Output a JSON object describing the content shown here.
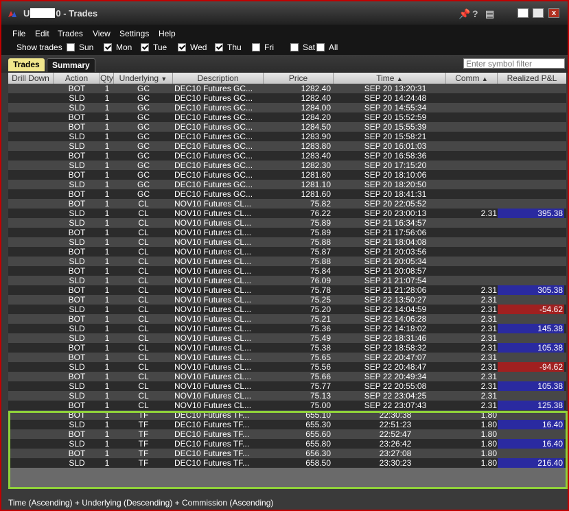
{
  "window": {
    "title_prefix": "U",
    "title_suffix": "0 - Trades"
  },
  "menu": [
    "File",
    "Edit",
    "Trades",
    "View",
    "Settings",
    "Help"
  ],
  "show_trades": {
    "label": "Show trades",
    "days": [
      {
        "label": "Sun",
        "checked": false
      },
      {
        "label": "Mon",
        "checked": true
      },
      {
        "label": "Tue",
        "checked": true
      },
      {
        "label": "Wed",
        "checked": true
      },
      {
        "label": "Thu",
        "checked": true
      },
      {
        "label": "Fri",
        "checked": false
      },
      {
        "label": "Sat",
        "checked": false
      },
      {
        "label": "All",
        "checked": false
      }
    ]
  },
  "tabs": [
    {
      "label": "Trades",
      "active": true
    },
    {
      "label": "Summary",
      "active": false
    }
  ],
  "filter": {
    "placeholder": "Enter symbol filter"
  },
  "columns": [
    "Drill Down",
    "Action",
    "Qty",
    "Underlying",
    "Description",
    "Price",
    "Time",
    "Comm",
    "Realized P&L"
  ],
  "rows": [
    {
      "action": "BOT",
      "qty": "1",
      "und": "GC",
      "desc": "DEC10 Futures GC...",
      "price": "1282.40",
      "time": "SEP 20 13:20:31",
      "comm": "",
      "pnl": ""
    },
    {
      "action": "SLD",
      "qty": "1",
      "und": "GC",
      "desc": "DEC10 Futures GC...",
      "price": "1282.40",
      "time": "SEP 20 14:24:48",
      "comm": "",
      "pnl": ""
    },
    {
      "action": "SLD",
      "qty": "1",
      "und": "GC",
      "desc": "DEC10 Futures GC...",
      "price": "1284.00",
      "time": "SEP 20 14:55:34",
      "comm": "",
      "pnl": ""
    },
    {
      "action": "BOT",
      "qty": "1",
      "und": "GC",
      "desc": "DEC10 Futures GC...",
      "price": "1284.20",
      "time": "SEP 20 15:52:59",
      "comm": "",
      "pnl": ""
    },
    {
      "action": "BOT",
      "qty": "1",
      "und": "GC",
      "desc": "DEC10 Futures GC...",
      "price": "1284.50",
      "time": "SEP 20 15:55:39",
      "comm": "",
      "pnl": ""
    },
    {
      "action": "SLD",
      "qty": "1",
      "und": "GC",
      "desc": "DEC10 Futures GC...",
      "price": "1283.90",
      "time": "SEP 20 15:58:21",
      "comm": "",
      "pnl": ""
    },
    {
      "action": "SLD",
      "qty": "1",
      "und": "GC",
      "desc": "DEC10 Futures GC...",
      "price": "1283.80",
      "time": "SEP 20 16:01:03",
      "comm": "",
      "pnl": ""
    },
    {
      "action": "BOT",
      "qty": "1",
      "und": "GC",
      "desc": "DEC10 Futures GC...",
      "price": "1283.40",
      "time": "SEP 20 16:58:36",
      "comm": "",
      "pnl": ""
    },
    {
      "action": "SLD",
      "qty": "1",
      "und": "GC",
      "desc": "DEC10 Futures GC...",
      "price": "1282.30",
      "time": "SEP 20 17:15:20",
      "comm": "",
      "pnl": ""
    },
    {
      "action": "BOT",
      "qty": "1",
      "und": "GC",
      "desc": "DEC10 Futures GC...",
      "price": "1281.80",
      "time": "SEP 20 18:10:06",
      "comm": "",
      "pnl": ""
    },
    {
      "action": "SLD",
      "qty": "1",
      "und": "GC",
      "desc": "DEC10 Futures GC...",
      "price": "1281.10",
      "time": "SEP 20 18:20:50",
      "comm": "",
      "pnl": ""
    },
    {
      "action": "BOT",
      "qty": "1",
      "und": "GC",
      "desc": "DEC10 Futures GC...",
      "price": "1281.60",
      "time": "SEP 20 18:41:31",
      "comm": "",
      "pnl": ""
    },
    {
      "action": "BOT",
      "qty": "1",
      "und": "CL",
      "desc": "NOV10 Futures CL...",
      "price": "75.82",
      "time": "SEP 20 22:05:52",
      "comm": "",
      "pnl": ""
    },
    {
      "action": "SLD",
      "qty": "1",
      "und": "CL",
      "desc": "NOV10 Futures CL...",
      "price": "76.22",
      "time": "SEP 20 23:00:13",
      "comm": "2.31",
      "pnl": "395.38",
      "sign": "pos"
    },
    {
      "action": "SLD",
      "qty": "1",
      "und": "CL",
      "desc": "NOV10 Futures CL...",
      "price": "75.89",
      "time": "SEP 21 16:34:57",
      "comm": "",
      "pnl": ""
    },
    {
      "action": "BOT",
      "qty": "1",
      "und": "CL",
      "desc": "NOV10 Futures CL...",
      "price": "75.89",
      "time": "SEP 21 17:56:06",
      "comm": "",
      "pnl": ""
    },
    {
      "action": "SLD",
      "qty": "1",
      "und": "CL",
      "desc": "NOV10 Futures CL...",
      "price": "75.88",
      "time": "SEP 21 18:04:08",
      "comm": "",
      "pnl": ""
    },
    {
      "action": "BOT",
      "qty": "1",
      "und": "CL",
      "desc": "NOV10 Futures CL...",
      "price": "75.87",
      "time": "SEP 21 20:03:56",
      "comm": "",
      "pnl": ""
    },
    {
      "action": "SLD",
      "qty": "1",
      "und": "CL",
      "desc": "NOV10 Futures CL...",
      "price": "75.88",
      "time": "SEP 21 20:05:34",
      "comm": "",
      "pnl": ""
    },
    {
      "action": "BOT",
      "qty": "1",
      "und": "CL",
      "desc": "NOV10 Futures CL...",
      "price": "75.84",
      "time": "SEP 21 20:08:57",
      "comm": "",
      "pnl": ""
    },
    {
      "action": "SLD",
      "qty": "1",
      "und": "CL",
      "desc": "NOV10 Futures CL...",
      "price": "76.09",
      "time": "SEP 21 21:07:54",
      "comm": "",
      "pnl": ""
    },
    {
      "action": "BOT",
      "qty": "1",
      "und": "CL",
      "desc": "NOV10 Futures CL...",
      "price": "75.78",
      "time": "SEP 21 21:28:06",
      "comm": "2.31",
      "pnl": "305.38",
      "sign": "pos"
    },
    {
      "action": "BOT",
      "qty": "1",
      "und": "CL",
      "desc": "NOV10 Futures CL...",
      "price": "75.25",
      "time": "SEP 22 13:50:27",
      "comm": "2.31",
      "pnl": ""
    },
    {
      "action": "SLD",
      "qty": "1",
      "und": "CL",
      "desc": "NOV10 Futures CL...",
      "price": "75.20",
      "time": "SEP 22 14:04:59",
      "comm": "2.31",
      "pnl": "-54.62",
      "sign": "neg"
    },
    {
      "action": "BOT",
      "qty": "1",
      "und": "CL",
      "desc": "NOV10 Futures CL...",
      "price": "75.21",
      "time": "SEP 22 14:06:28",
      "comm": "2.31",
      "pnl": ""
    },
    {
      "action": "SLD",
      "qty": "1",
      "und": "CL",
      "desc": "NOV10 Futures CL...",
      "price": "75.36",
      "time": "SEP 22 14:18:02",
      "comm": "2.31",
      "pnl": "145.38",
      "sign": "pos"
    },
    {
      "action": "SLD",
      "qty": "1",
      "und": "CL",
      "desc": "NOV10 Futures CL...",
      "price": "75.49",
      "time": "SEP 22 18:31:46",
      "comm": "2.31",
      "pnl": ""
    },
    {
      "action": "BOT",
      "qty": "1",
      "und": "CL",
      "desc": "NOV10 Futures CL...",
      "price": "75.38",
      "time": "SEP 22 18:58:32",
      "comm": "2.31",
      "pnl": "105.38",
      "sign": "pos"
    },
    {
      "action": "BOT",
      "qty": "1",
      "und": "CL",
      "desc": "NOV10 Futures CL...",
      "price": "75.65",
      "time": "SEP 22 20:47:07",
      "comm": "2.31",
      "pnl": ""
    },
    {
      "action": "SLD",
      "qty": "1",
      "und": "CL",
      "desc": "NOV10 Futures CL...",
      "price": "75.56",
      "time": "SEP 22 20:48:47",
      "comm": "2.31",
      "pnl": "-94.62",
      "sign": "neg"
    },
    {
      "action": "BOT",
      "qty": "1",
      "und": "CL",
      "desc": "NOV10 Futures CL...",
      "price": "75.66",
      "time": "SEP 22 20:49:34",
      "comm": "2.31",
      "pnl": ""
    },
    {
      "action": "SLD",
      "qty": "1",
      "und": "CL",
      "desc": "NOV10 Futures CL...",
      "price": "75.77",
      "time": "SEP 22 20:55:08",
      "comm": "2.31",
      "pnl": "105.38",
      "sign": "pos"
    },
    {
      "action": "SLD",
      "qty": "1",
      "und": "CL",
      "desc": "NOV10 Futures CL...",
      "price": "75.13",
      "time": "SEP 22 23:04:25",
      "comm": "2.31",
      "pnl": ""
    },
    {
      "action": "BOT",
      "qty": "1",
      "und": "CL",
      "desc": "NOV10 Futures CL...",
      "price": "75.00",
      "time": "SEP 22 23:07:43",
      "comm": "2.31",
      "pnl": "125.38",
      "sign": "pos"
    },
    {
      "action": "BOT",
      "qty": "1",
      "und": "TF",
      "desc": "DEC10 Futures TF...",
      "price": "655.10",
      "time": "22:30:38",
      "comm": "1.80",
      "pnl": ""
    },
    {
      "action": "SLD",
      "qty": "1",
      "und": "TF",
      "desc": "DEC10 Futures TF...",
      "price": "655.30",
      "time": "22:51:23",
      "comm": "1.80",
      "pnl": "16.40",
      "sign": "pos"
    },
    {
      "action": "BOT",
      "qty": "1",
      "und": "TF",
      "desc": "DEC10 Futures TF...",
      "price": "655.60",
      "time": "22:52:47",
      "comm": "1.80",
      "pnl": ""
    },
    {
      "action": "SLD",
      "qty": "1",
      "und": "TF",
      "desc": "DEC10 Futures TF...",
      "price": "655.80",
      "time": "23:26:42",
      "comm": "1.80",
      "pnl": "16.40",
      "sign": "pos"
    },
    {
      "action": "BOT",
      "qty": "1",
      "und": "TF",
      "desc": "DEC10 Futures TF...",
      "price": "656.30",
      "time": "23:27:08",
      "comm": "1.80",
      "pnl": ""
    },
    {
      "action": "SLD",
      "qty": "1",
      "und": "TF",
      "desc": "DEC10 Futures TF...",
      "price": "658.50",
      "time": "23:30:23",
      "comm": "1.80",
      "pnl": "216.40",
      "sign": "pos"
    }
  ],
  "status": "Time (Ascending)  +  Underlying (Descending)  +  Commission (Ascending)",
  "colors": {
    "accent_tab": "#f0e68c",
    "pnl_positive": "#2a2aa0",
    "pnl_negative": "#a02020",
    "highlight": "#8fd13a",
    "window_border": "#c00000"
  },
  "icons": [
    "app-icon",
    "pin-icon",
    "help-icon",
    "print-icon",
    "minimize-icon",
    "maximize-icon",
    "close-icon",
    "sort-descending-icon",
    "sort-ascending-icon"
  ]
}
